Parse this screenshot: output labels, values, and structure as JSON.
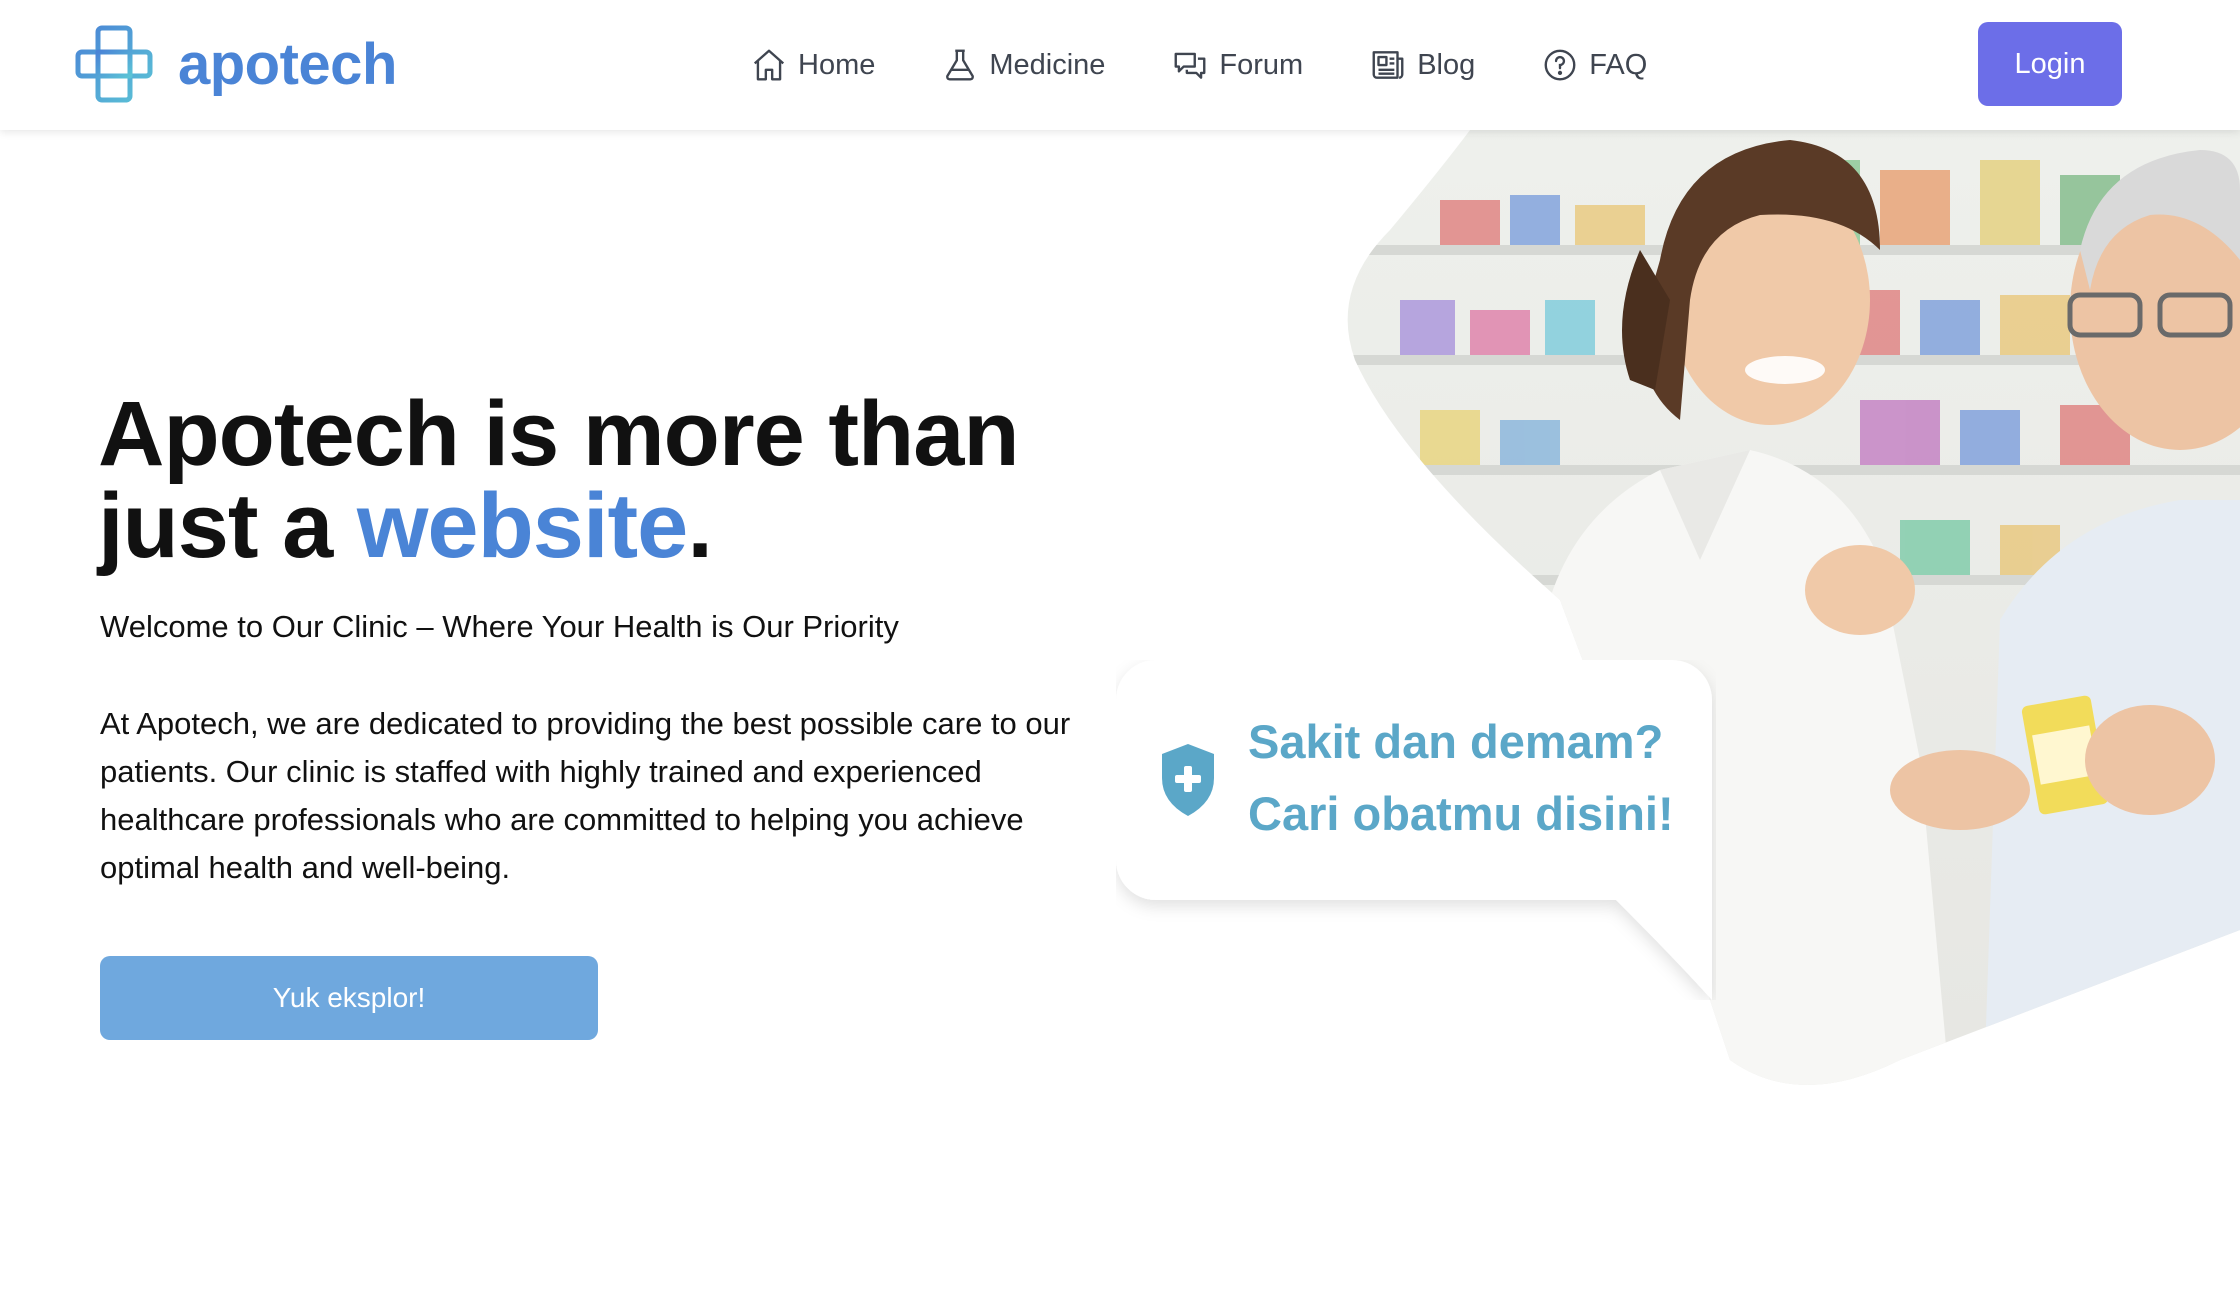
{
  "brand": {
    "name": "apotech",
    "color": "#4a84d6",
    "icon": "cross-logo-icon"
  },
  "nav": {
    "items": [
      {
        "label": "Home",
        "icon": "home-icon"
      },
      {
        "label": "Medicine",
        "icon": "flask-icon"
      },
      {
        "label": "Forum",
        "icon": "chat-bubbles-icon"
      },
      {
        "label": "Blog",
        "icon": "newspaper-icon"
      },
      {
        "label": "FAQ",
        "icon": "question-circle-icon"
      }
    ],
    "login_label": "Login",
    "login_color": "#6c6ee8"
  },
  "hero": {
    "title_part1": "Apotech is more than",
    "title_part2": "just a ",
    "title_accent": "website",
    "title_end": ".",
    "subtitle": "Welcome to Our Clinic – Where Your Health is Our Priority",
    "body": "At Apotech, we are dedicated to providing the best possible care to our patients. Our clinic is staffed with highly trained and experienced healthcare professionals who are committed to helping you achieve optimal health and well-being.",
    "cta_label": "Yuk eksplor!",
    "cta_color": "#6fa8de"
  },
  "callout": {
    "icon": "shield-plus-icon",
    "line1": "Sakit dan demam?",
    "line2": "Cari obatmu disini!",
    "color": "#5ba7c8"
  }
}
